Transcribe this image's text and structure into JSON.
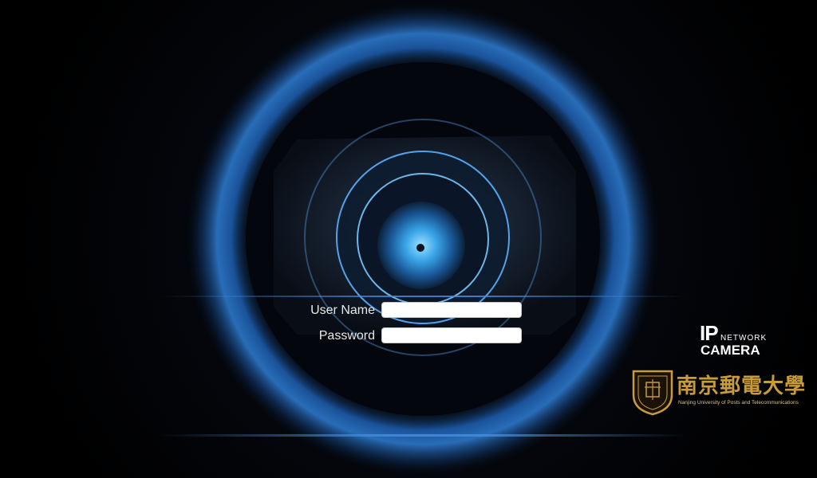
{
  "login": {
    "username_label": "User Name",
    "username_value": "",
    "password_label": "Password",
    "password_value": ""
  },
  "brand": {
    "ip": "IP",
    "network": "NETWORK",
    "camera": "CAMERA"
  },
  "university": {
    "chinese_name": "南京郵電大學",
    "english_name": "Nanjing University of Posts and Telecommunications"
  },
  "colors": {
    "background": "#000000",
    "lens_ring": "#2a6fc9",
    "lens_glow": "#4ea3ff",
    "university_gold": "#c89b3c"
  }
}
